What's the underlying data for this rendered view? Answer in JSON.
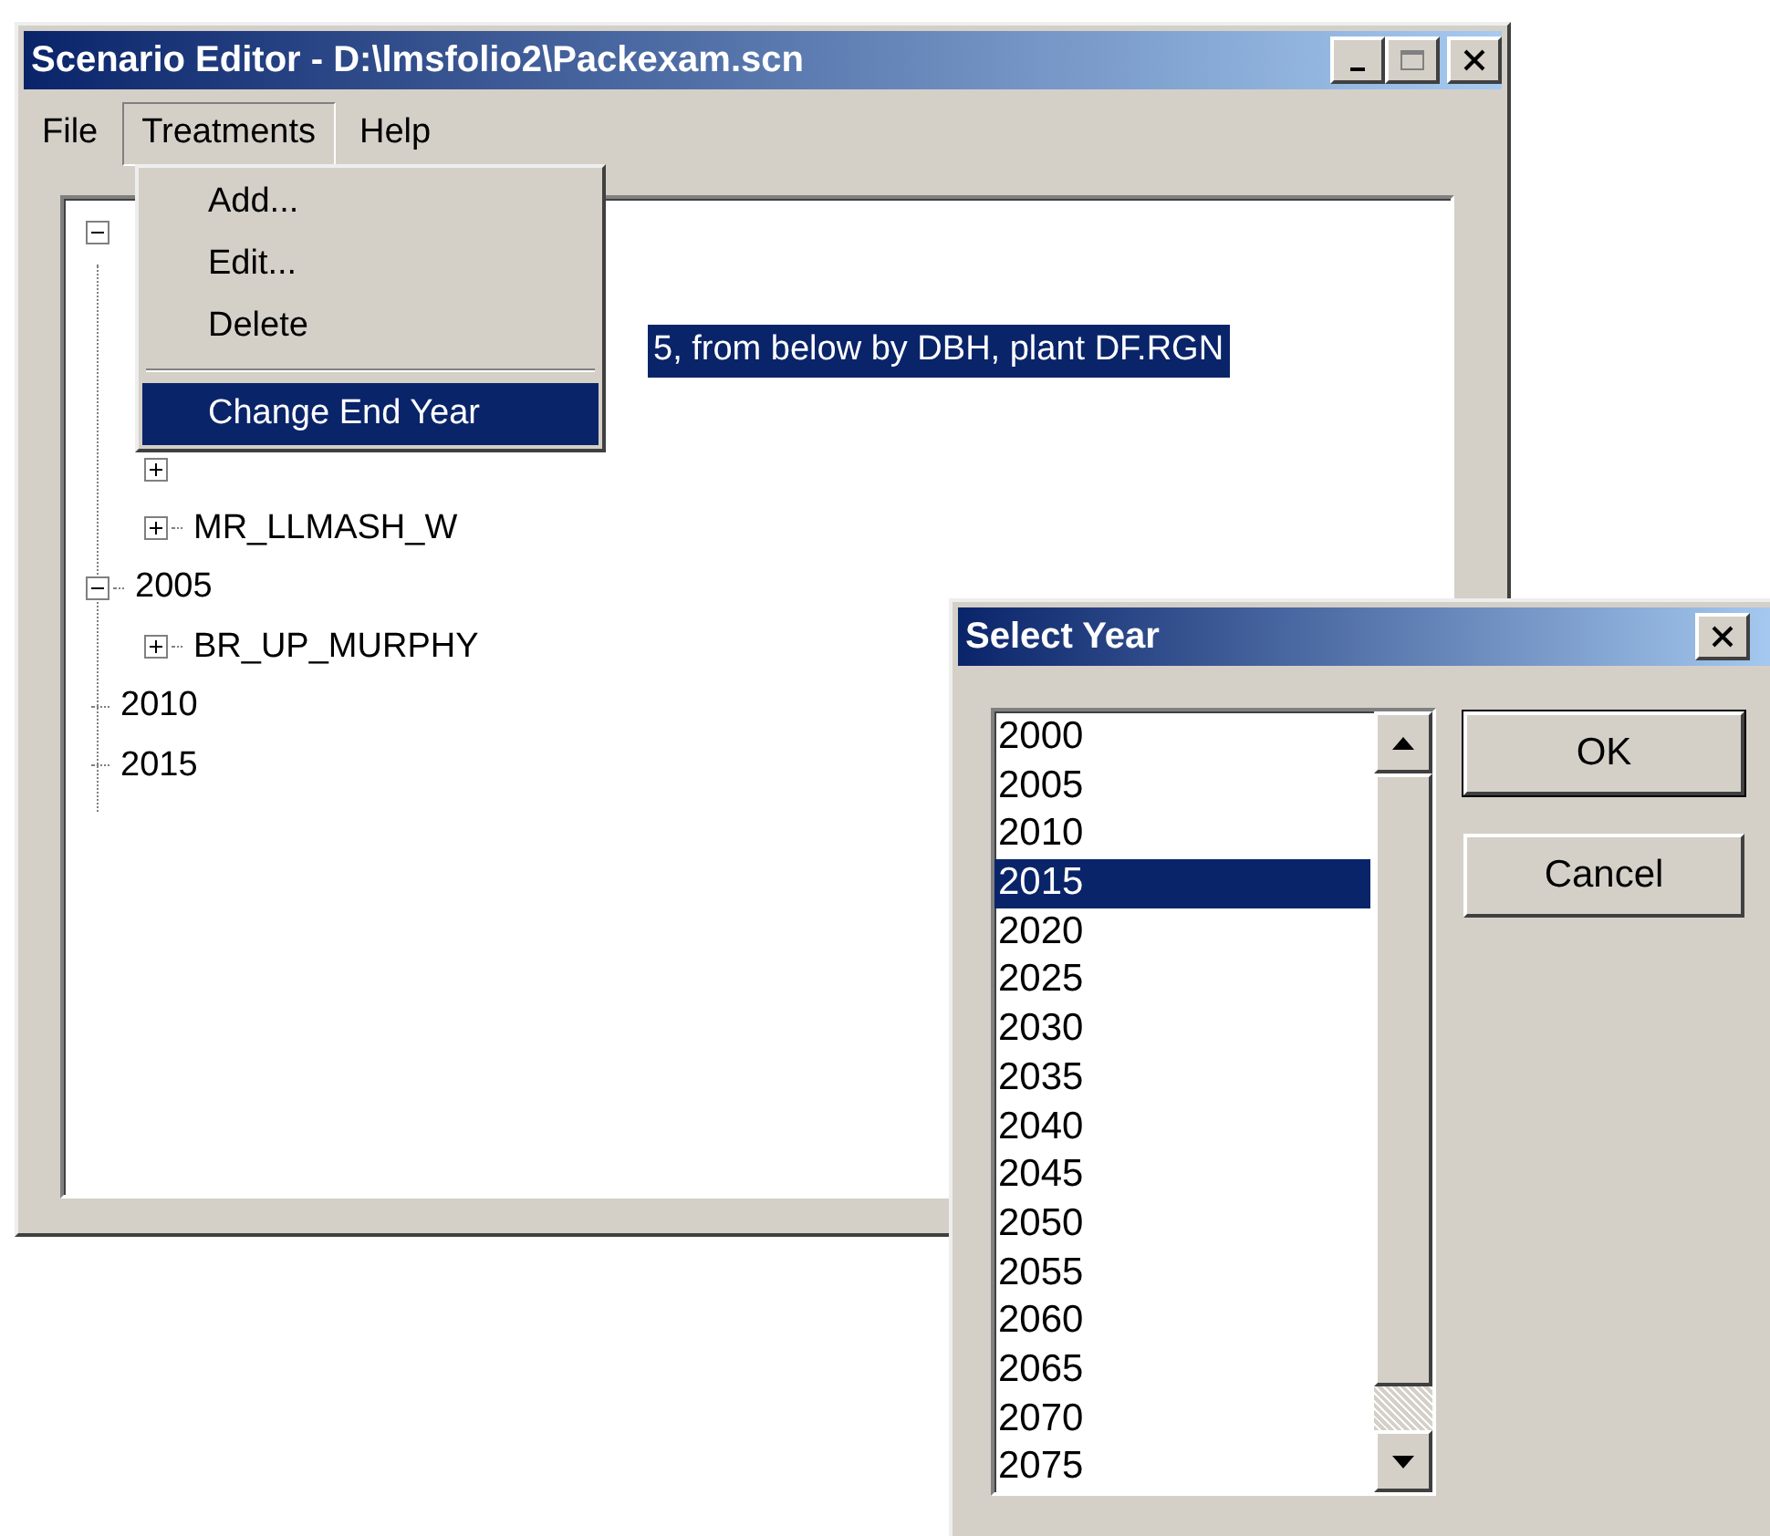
{
  "window": {
    "title": "Scenario Editor - D:\\lmsfolio2\\Packexam.scn"
  },
  "menu_bar": [
    {
      "label": "File",
      "open": false
    },
    {
      "label": "Treatments",
      "open": true
    },
    {
      "label": "Help",
      "open": false
    }
  ],
  "menu": [
    {
      "kind": "item",
      "label": "Add...",
      "selected": false
    },
    {
      "kind": "item",
      "label": "Edit...",
      "selected": false
    },
    {
      "kind": "item",
      "label": "Delete",
      "selected": false
    },
    {
      "kind": "separator"
    },
    {
      "kind": "item",
      "label": "Change End Year",
      "selected": true
    }
  ],
  "tree": [
    {
      "expanded": true,
      "children": [
        {
          "kind": "clipped",
          "label": "5, from below by DBH, plant DF.RGN",
          "selected": true
        },
        {
          "expanded": false
        },
        {
          "label": "MR_LLMASH_W",
          "expanded": false,
          "selected": false
        }
      ]
    },
    {
      "label": "2005",
      "expanded": true,
      "selected": false,
      "children": [
        {
          "label": "BR_UP_MURPHY",
          "expanded": false,
          "selected": false
        }
      ]
    },
    {
      "label": "2010",
      "selected": false
    },
    {
      "label": "2015",
      "selected": false
    }
  ],
  "dialog": {
    "title": "Select Year",
    "years": [
      {
        "label": "2000",
        "selected": false
      },
      {
        "label": "2005",
        "selected": false
      },
      {
        "label": "2010",
        "selected": false
      },
      {
        "label": "2015",
        "selected": true
      },
      {
        "label": "2020",
        "selected": false
      },
      {
        "label": "2025",
        "selected": false
      },
      {
        "label": "2030",
        "selected": false
      },
      {
        "label": "2035",
        "selected": false
      },
      {
        "label": "2040",
        "selected": false
      },
      {
        "label": "2045",
        "selected": false
      },
      {
        "label": "2050",
        "selected": false
      },
      {
        "label": "2055",
        "selected": false
      },
      {
        "label": "2060",
        "selected": false
      },
      {
        "label": "2065",
        "selected": false
      },
      {
        "label": "2070",
        "selected": false
      },
      {
        "label": "2075",
        "selected": false
      }
    ],
    "buttons": [
      {
        "label": "OK",
        "default": true
      },
      {
        "label": "Cancel",
        "default": false
      }
    ]
  }
}
